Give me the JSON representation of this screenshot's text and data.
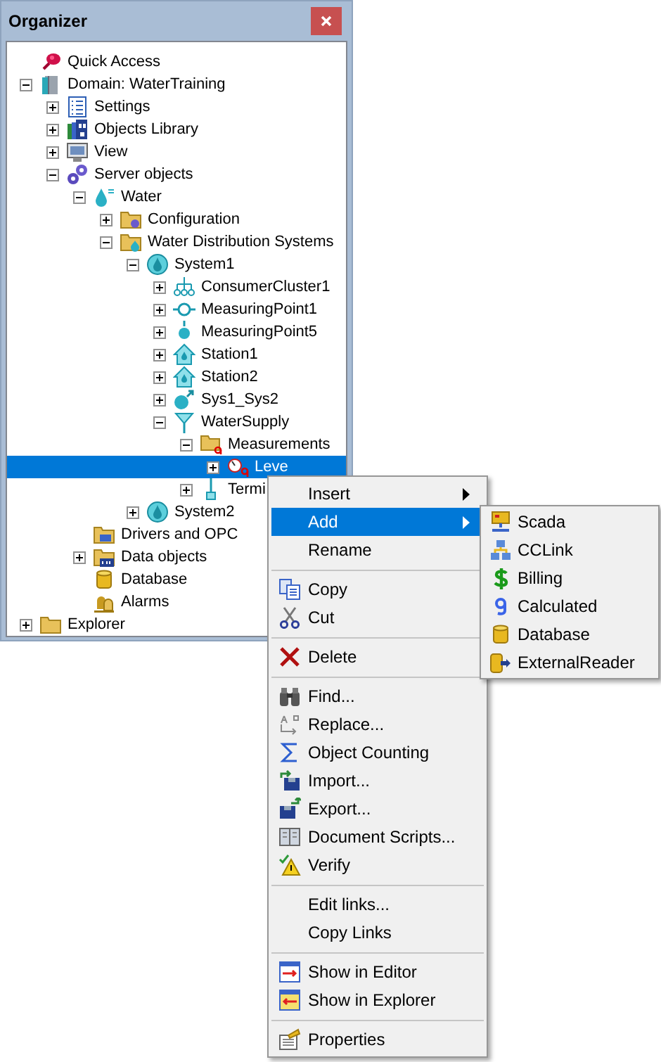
{
  "panel": {
    "title": "Organizer"
  },
  "tree": [
    {
      "label": "Quick Access",
      "kind": "pin",
      "selected": false
    },
    {
      "label": "Domain: WaterTraining",
      "kind": "server",
      "expanded": true,
      "selected": false,
      "children": [
        {
          "label": "Settings",
          "kind": "list",
          "expanded": false,
          "selected": false
        },
        {
          "label": "Objects Library",
          "kind": "library",
          "expanded": false,
          "selected": false
        },
        {
          "label": "View",
          "kind": "monitor",
          "expanded": false,
          "selected": false
        },
        {
          "label": "Server objects",
          "kind": "gears",
          "expanded": true,
          "selected": false,
          "children": [
            {
              "label": "Water",
              "kind": "drop",
              "expanded": true,
              "selected": false,
              "children": [
                {
                  "label": "Configuration",
                  "kind": "folder-gear",
                  "expanded": false,
                  "selected": false
                },
                {
                  "label": "Water Distribution Systems",
                  "kind": "folder-drop",
                  "expanded": true,
                  "selected": false,
                  "children": [
                    {
                      "label": "System1",
                      "kind": "system",
                      "expanded": true,
                      "selected": false,
                      "children": [
                        {
                          "label": "ConsumerCluster1",
                          "kind": "cluster",
                          "expanded": false,
                          "selected": false
                        },
                        {
                          "label": "MeasuringPoint1",
                          "kind": "mpoint",
                          "expanded": false,
                          "selected": false
                        },
                        {
                          "label": "MeasuringPoint5",
                          "kind": "mpoint-end",
                          "expanded": false,
                          "selected": false
                        },
                        {
                          "label": "Station1",
                          "kind": "station",
                          "expanded": false,
                          "selected": false
                        },
                        {
                          "label": "Station2",
                          "kind": "station",
                          "expanded": false,
                          "selected": false
                        },
                        {
                          "label": "Sys1_Sys2",
                          "kind": "link",
                          "expanded": false,
                          "selected": false
                        },
                        {
                          "label": "WaterSupply",
                          "kind": "funnel",
                          "expanded": true,
                          "selected": false,
                          "children": [
                            {
                              "label": "Measurements",
                              "kind": "folder-calc",
                              "expanded": true,
                              "selected": false,
                              "children": [
                                {
                                  "label": "Leve",
                                  "kind": "gauge",
                                  "expanded": false,
                                  "selected": true
                                }
                              ]
                            },
                            {
                              "label": "Termi",
                              "kind": "terminal",
                              "expanded": false,
                              "selected": false
                            }
                          ]
                        }
                      ]
                    },
                    {
                      "label": "System2",
                      "kind": "system",
                      "expanded": false,
                      "selected": false
                    }
                  ]
                }
              ]
            },
            {
              "label": "Drivers and OPC",
              "kind": "folder-driver",
              "selected": false
            },
            {
              "label": "Data objects",
              "kind": "folder-data",
              "expanded": false,
              "selected": false
            },
            {
              "label": "Database",
              "kind": "database",
              "selected": false
            },
            {
              "label": "Alarms",
              "kind": "alarm",
              "selected": false
            }
          ]
        }
      ]
    },
    {
      "label": "Explorer",
      "kind": "folder",
      "expanded": false,
      "selected": false
    }
  ],
  "context_menu": [
    {
      "kind": "item",
      "label": "Insert",
      "submenu": true,
      "selected": false
    },
    {
      "kind": "item",
      "label": "Add",
      "submenu": true,
      "selected": true
    },
    {
      "kind": "item",
      "label": "Rename",
      "selected": false
    },
    {
      "kind": "separator"
    },
    {
      "kind": "item",
      "label": "Copy",
      "selected": false
    },
    {
      "kind": "item",
      "label": "Cut",
      "selected": false
    },
    {
      "kind": "separator"
    },
    {
      "kind": "item",
      "label": "Delete",
      "selected": false
    },
    {
      "kind": "separator"
    },
    {
      "kind": "item",
      "label": "Find...",
      "selected": false
    },
    {
      "kind": "item",
      "label": "Replace...",
      "selected": false
    },
    {
      "kind": "item",
      "label": "Object Counting",
      "selected": false
    },
    {
      "kind": "item",
      "label": "Import...",
      "selected": false
    },
    {
      "kind": "item",
      "label": "Export...",
      "selected": false
    },
    {
      "kind": "item",
      "label": "Document Scripts...",
      "selected": false
    },
    {
      "kind": "item",
      "label": "Verify",
      "selected": false
    },
    {
      "kind": "separator"
    },
    {
      "kind": "item",
      "label": "Edit links...",
      "selected": false
    },
    {
      "kind": "item",
      "label": "Copy Links",
      "selected": false
    },
    {
      "kind": "separator"
    },
    {
      "kind": "item",
      "label": "Show in Editor",
      "selected": false
    },
    {
      "kind": "item",
      "label": "Show in Explorer",
      "selected": false
    },
    {
      "kind": "separator"
    },
    {
      "kind": "item",
      "label": "Properties",
      "selected": false
    }
  ],
  "submenu": [
    {
      "label": "Scada",
      "selected": false
    },
    {
      "label": "CCLink",
      "selected": false
    },
    {
      "label": "Billing",
      "selected": false
    },
    {
      "label": "Calculated",
      "selected": false
    },
    {
      "label": "Database",
      "selected": false
    },
    {
      "label": "ExternalReader",
      "selected": false
    }
  ]
}
